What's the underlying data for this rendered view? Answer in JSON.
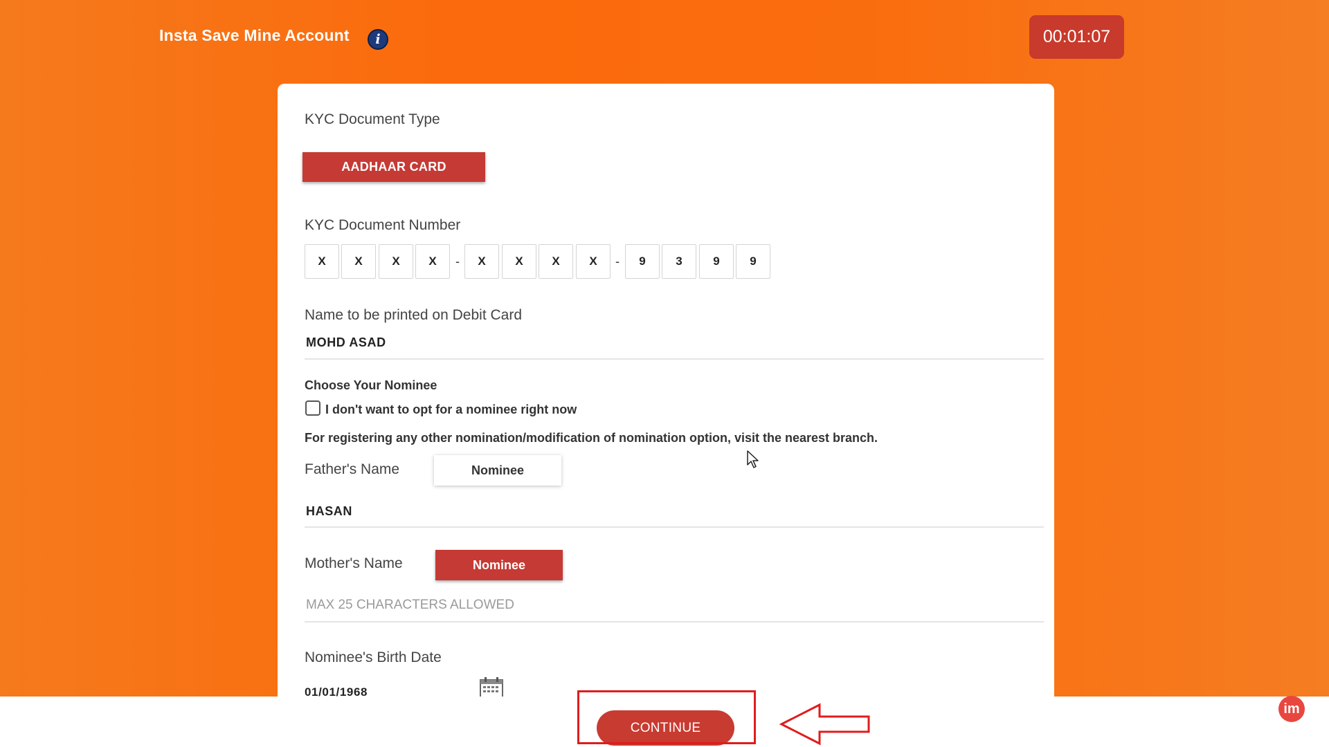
{
  "header": {
    "title": "Insta Save Mine Account",
    "info_icon_glyph": "i",
    "timer": "00:01:07"
  },
  "form": {
    "kyc_type_label": "KYC Document Type",
    "kyc_type_value": "AADHAAR CARD",
    "kyc_number_label": "KYC Document Number",
    "kyc_number_digits": [
      "X",
      "X",
      "X",
      "X",
      "X",
      "X",
      "X",
      "X",
      "9",
      "3",
      "9",
      "9"
    ],
    "kyc_number_separator": "-",
    "debit_name_label": "Name to be printed on Debit Card",
    "debit_name_value": "MOHD ASAD",
    "nominee_heading": "Choose Your Nominee",
    "no_nominee_checkbox_label": "I don't want to opt for a nominee right now",
    "no_nominee_checked": false,
    "nomination_note": "For registering any other nomination/modification of nomination option, visit the nearest branch.",
    "father_label": "Father's Name",
    "father_nominee_button": "Nominee",
    "father_value": "HASAN",
    "mother_label": "Mother's Name",
    "mother_nominee_button": "Nominee",
    "mother_placeholder": "MAX 25 CHARACTERS ALLOWED",
    "birth_date_label": "Nominee's Birth Date",
    "birth_date_value": "01/01/1968"
  },
  "footer": {
    "continue_label": "CONTINUE",
    "brand_badge": "im"
  },
  "colors": {
    "background": "#fa6d0e",
    "primary_red": "#c53a34",
    "highlight": "#e01c1c"
  }
}
